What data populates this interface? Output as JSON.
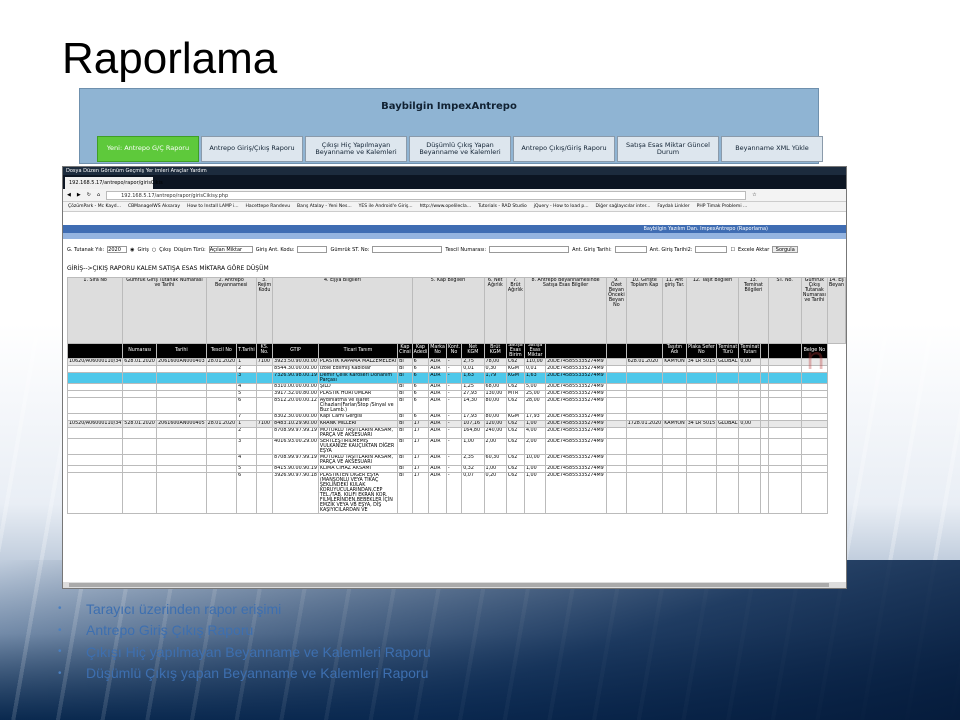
{
  "slide": {
    "title": "Raporlama"
  },
  "app": {
    "title": "Baybilgin ImpexAntrepo",
    "buttons": [
      "Yeni: Antrepo G/Ç Raporu",
      "Antrepo Giriş/Çıkış Raporu",
      "Çıkışı Hiç Yapılmayan Beyanname ve Kalemleri",
      "Düşümlü Çıkış Yapan Beyanname ve Kalemleri",
      "Antrepo Çıkış/Giriş Raporu",
      "Satışa Esas Miktar Güncel Durum",
      "Beyanname XML Yükle"
    ]
  },
  "browser": {
    "menu": "Dosya  Düzen  Görünüm  Geçmiş  Yer imleri  Araçlar  Yardım",
    "tab": "192.168.5.17/antrepo/rapor/girisCikis",
    "url": "192.168.5.17/antrepo/rapor/girisCikisy.php",
    "bookmarks": [
      "ÇözümPark - Mc Kayd...",
      "CBManagelWS Aksaray",
      "How to Install LAMP i...",
      "Hacettepe Randevu",
      "Barış Atalay - Yeni Nes...",
      "YES ile Android'e Giriş...",
      "http://www.opelilecla...",
      "Tutorials - RAD Studio",
      "jQuery - How to load p...",
      "Diğer sağlayıcılar inter...",
      "Faydalı Linkler",
      "PHP Timak Problemi ..."
    ],
    "page_header": "Baybilgin Yazılım Dan. ImpexAntrepo (Raporlama)"
  },
  "filter": {
    "year_label": "G. Tutanak Yılı:",
    "year": "2020",
    "radio_giris": "Giriş",
    "radio_cikis": "Çıkış",
    "dusum_label": "Düşüm Türü:",
    "dusum": "Açılan Miktar",
    "giris_ant_label": "Giriş Ant. Kodu:",
    "gumruk_label": "Gümrük ST. No:",
    "tescil_label": "Tescil Numarası:",
    "ant_giris_label": "Ant. Giriş Tarihi:",
    "ant_giris2_label": "Ant. Giriş Tarihi2:",
    "excel_label": "Excele Aktar",
    "submit": "Sorgula"
  },
  "report_title": "GİRİŞ-->ÇIKIŞ RAPORU KALEM SATIŞA ESAS MİKTARA GÖRE DÜŞÜM",
  "table": {
    "header1": [
      "1. Sıra No",
      "Gümrük Giriş Tutanak Numarası ve Tarihi",
      "2. Antrepo Beyannamesi",
      "3. Rejim Kodu",
      "4. Eşya Bilgileri",
      "5. Kap Bilgileri",
      "6. Net Ağırlık",
      "7. Brüt Ağırlık",
      "8. Antrepo Beyannamesinde Satışa Esas Bilgiler",
      "9. Özet Beyan Önceki Beyan No",
      "10. Girişte Toplam Kap",
      "11. Ant giriş Tar.",
      "12. Taşıt Bilgileri",
      "13. Teminat Bilgileri",
      "ST. No.",
      "Gümrük Çıkış Tutanak Numarası ve Tarihi",
      "14. Eş Beyan"
    ],
    "header2": [
      "",
      "Numarası",
      "Tarihi",
      "Tescil No",
      "T.Tarihi",
      "KS. No.",
      "GTIP",
      "Ticari Tanım",
      "Kap Cinsi",
      "Kap Adedi",
      "Marka No",
      "Kont. No",
      "Net KGM",
      "Brüt KGM",
      "Satışa Esas Birim",
      "Satışa Esas Miktar",
      "",
      "",
      "",
      "Taşıtın Adı",
      "Plaka Sefer No",
      "Teminat Türü",
      "Teminat Tutarı",
      "",
      "",
      "Belge No"
    ],
    "rows": [
      [
        "10620/A06000110/34",
        "628.01.2020",
        "2061600AN000403",
        "28.01.2020",
        "1",
        "7100",
        "3923.50.90.00.00",
        "PLASTİK KAPAMA MALZEMELERİ",
        "BI",
        "6",
        "ADR",
        "-",
        "2,75",
        "78,00",
        "C62",
        "110,00",
        "20DE745855335274M9",
        "",
        "628.01.2020",
        "KAMYON",
        "34 LR 5015",
        "GLOBAL",
        "0,00",
        "",
        "",
        ""
      ],
      [
        "",
        "",
        "",
        "",
        "2",
        "",
        "8544.30.00.00.00",
        "Izole Edilmiş Kablolar",
        "BI",
        "6",
        "ADR",
        "-",
        "0,01",
        "0,30",
        "KGM",
        "0,01",
        "20DE745855335274M9",
        "",
        "",
        "",
        "",
        "",
        "",
        "",
        "",
        ""
      ],
      [
        "",
        "",
        "",
        "",
        "3",
        "",
        "7326.90.98.00.19",
        "Demir Çelik Karoseri Donanım Parçası",
        "BI",
        "6",
        "ADR",
        "-",
        "1,63",
        "1,79",
        "KGM",
        "1,63",
        "20DE745855335274M9",
        "",
        "",
        "",
        "",
        "",
        "",
        "",
        "",
        ""
      ],
      [
        "",
        "",
        "",
        "",
        "4",
        "",
        "8310.00.00.00.00",
        "ŞİLD",
        "BI",
        "6",
        "ADR",
        "-",
        "1,25",
        "68,00",
        "C62",
        "5,00",
        "20DE745855335274M9",
        "",
        "",
        "",
        "",
        "",
        "",
        "",
        "",
        ""
      ],
      [
        "",
        "",
        "",
        "",
        "5",
        "",
        "3917.32.00.80.00",
        "PLASTİK HORTUMLAR",
        "BI",
        "6",
        "ADR",
        "-",
        "27,93",
        "130,00",
        "MTR",
        "25,00",
        "20DE745855335274M9",
        "",
        "",
        "",
        "",
        "",
        "",
        "",
        "",
        ""
      ],
      [
        "",
        "",
        "",
        "",
        "6",
        "",
        "8512.20.00.00.12",
        "Aydınlatma ve İşaret Cihazları(Farlar/Stop /Sinyal ve Buz Lamb.)",
        "BI",
        "6",
        "ADR",
        "-",
        "14,30",
        "80,00",
        "C62",
        "28,00",
        "20DE745855335274M9",
        "",
        "",
        "",
        "",
        "",
        "",
        "",
        "",
        ""
      ],
      [
        "",
        "",
        "",
        "",
        "7",
        "",
        "8302.30.00.00.00",
        "Kapı Camı Gergisi",
        "BI",
        "6",
        "ADR",
        "-",
        "17,93",
        "80,00",
        "KGM",
        "17,93",
        "20DE745855335274M9",
        "",
        "",
        "",
        "",
        "",
        "",
        "",
        "",
        ""
      ],
      [
        "10520/A06000110/34",
        "528.01.2020",
        "2061600AN000405",
        "28.01.2020",
        "1",
        "7100",
        "8483.10.29.90.00",
        "KRANK MİLLERİ",
        "BI",
        "17",
        "ADR",
        "-",
        "107,16",
        "120,00",
        "C62",
        "1,00",
        "20DE745855335274M9",
        "",
        "1728.01.2020",
        "KAMYON",
        "34 LR 5015",
        "GLOBAL",
        "0,00",
        "",
        "",
        ""
      ],
      [
        "",
        "",
        "",
        "",
        "2",
        "",
        "8708.99.97.99.19",
        "MOTORLU TAŞITLARIN AKSAM, PARÇA VE AKSESUARI",
        "BI",
        "17",
        "ADR",
        "-",
        "164,80",
        "240,00",
        "C62",
        "4,00",
        "20DE745855335274M9",
        "",
        "",
        "",
        "",
        "",
        "",
        "",
        "",
        ""
      ],
      [
        "",
        "",
        "",
        "",
        "3",
        "",
        "4016.93.00.29.00",
        "SERTLEŞTİRİLMEMİŞ VULKANİZE KAUÇUKTAN DİĞER EŞYA",
        "BI",
        "17",
        "ADR",
        "-",
        "1,00",
        "2,00",
        "C62",
        "2,00",
        "20DE745855335274M9",
        "",
        "",
        "",
        "",
        "",
        "",
        "",
        "",
        ""
      ],
      [
        "",
        "",
        "",
        "",
        "4",
        "",
        "8708.99.97.99.19",
        "MOTORLU TAŞITLARIN AKSAM, PARÇA VE AKSESUARI",
        "BI",
        "17",
        "ADR",
        "-",
        "2,35",
        "60,30",
        "C62",
        "10,00",
        "20DE745855335274M9",
        "",
        "",
        "",
        "",
        "",
        "",
        "",
        "",
        ""
      ],
      [
        "",
        "",
        "",
        "",
        "5",
        "",
        "8415.90.00.90.19",
        "KLİMA CİHAZ AKSAMI",
        "BI",
        "17",
        "ADR",
        "-",
        "0,32",
        "1,00",
        "C62",
        "1,00",
        "20DE745855335274M9",
        "",
        "",
        "",
        "",
        "",
        "",
        "",
        "",
        ""
      ],
      [
        "",
        "",
        "",
        "",
        "6",
        "",
        "3926.90.97.90.18",
        "PLASTİKTEN DİĞER EŞYA (MANŞONLU VEYA TIKAÇ ŞEKLİNDEKİ KULAK KORUYUCULARINDAN,CEP TEL./TAB. KILIFI EKRAN KOR. FILMLERİNDEN,BEBEKLER İÇİN EMZİK VEYA VB EŞYA, DİŞ KAŞIYICILARDAN VE",
        "BI",
        "17",
        "ADR",
        "-",
        "0,07",
        "0,20",
        "C62",
        "1,00",
        "20DE745855335274M9",
        "",
        "",
        "",
        "",
        "",
        "",
        "",
        "",
        ""
      ]
    ]
  },
  "bullets": [
    "Tarayıcı üzerinden rapor erişimi",
    "Antrepo Giriş Çıkış Raporu",
    "Çıkışı Hiç yapılmayan Beyanname ve Kalemleri Raporu",
    "Düşümlü Çıkış yapan Beyanname ve Kalemleri Raporu"
  ]
}
